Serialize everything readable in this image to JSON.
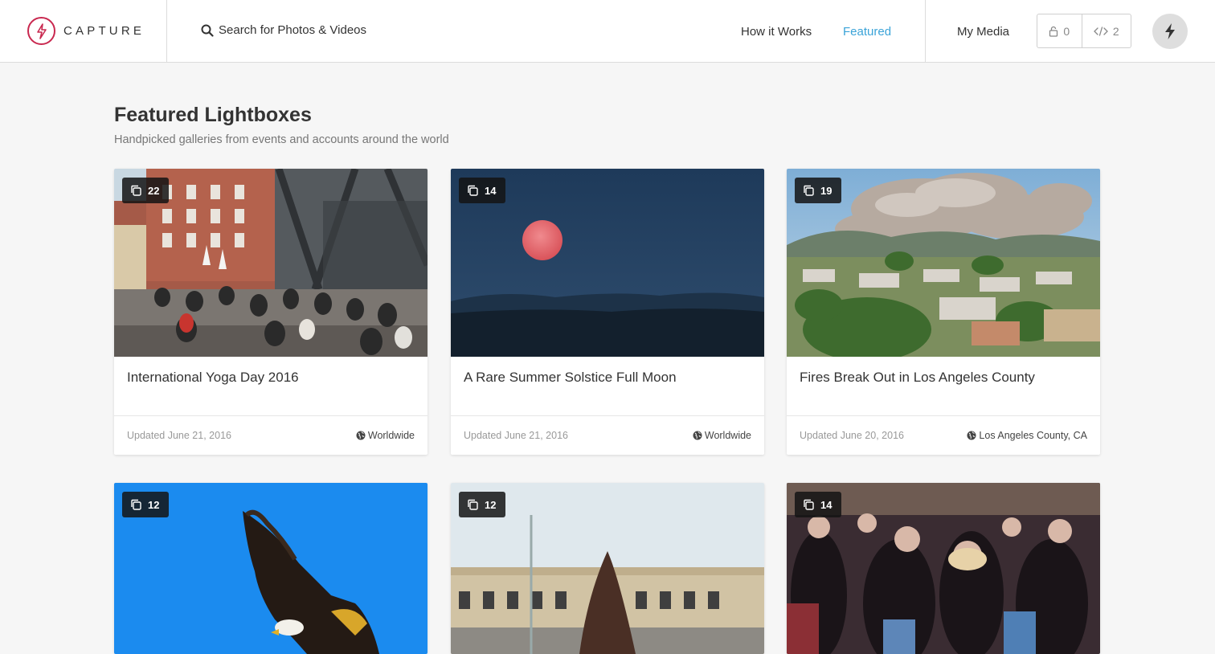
{
  "header": {
    "logo_text": "CAPTURE",
    "search_label": "Search for Photos & Videos",
    "nav_how": "How it Works",
    "nav_featured": "Featured",
    "nav_my_media": "My Media",
    "lock_count": "0",
    "embed_count": "2"
  },
  "page": {
    "title": "Featured Lightboxes",
    "subtitle": "Handpicked galleries from events and accounts around the world"
  },
  "cards": [
    {
      "count": "22",
      "title": "International Yoga Day 2016",
      "updated": "Updated June 21, 2016",
      "location": "Worldwide"
    },
    {
      "count": "14",
      "title": "A Rare Summer Solstice Full Moon",
      "updated": "Updated June 21, 2016",
      "location": "Worldwide"
    },
    {
      "count": "19",
      "title": "Fires Break Out in Los Angeles County",
      "updated": "Updated June 20, 2016",
      "location": "Los Angeles County, CA"
    },
    {
      "count": "12"
    },
    {
      "count": "12"
    },
    {
      "count": "14"
    }
  ],
  "colors": {
    "accent": "#3aa3d8",
    "brand": "#c9284f"
  }
}
